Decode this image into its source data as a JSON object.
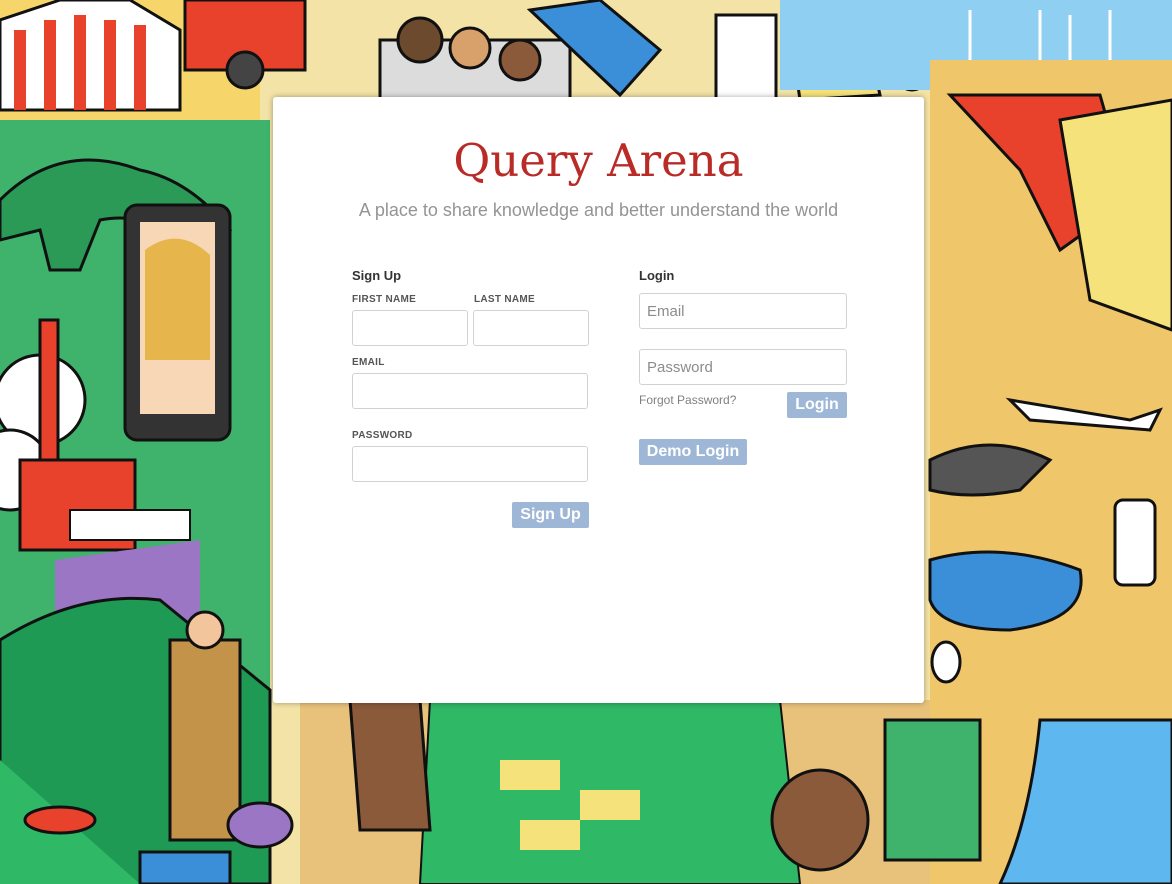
{
  "header": {
    "title": "Query Arena",
    "subtitle": "A place to share knowledge and better understand the world"
  },
  "signup": {
    "heading": "Sign Up",
    "first_name_label": "FIRST NAME",
    "first_name_value": "",
    "last_name_label": "LAST NAME",
    "last_name_value": "",
    "email_label": "EMAIL",
    "email_value": "",
    "password_label": "PASSWORD",
    "password_value": "",
    "submit_label": "Sign Up"
  },
  "login": {
    "heading": "Login",
    "email_placeholder": "Email",
    "password_placeholder": "Password",
    "forgot_label": "Forgot Password?",
    "submit_label": "Login",
    "demo_label": "Demo Login"
  },
  "colors": {
    "brand": "#b92b27",
    "button": "#9fb7d6",
    "subtitle": "#949494"
  }
}
